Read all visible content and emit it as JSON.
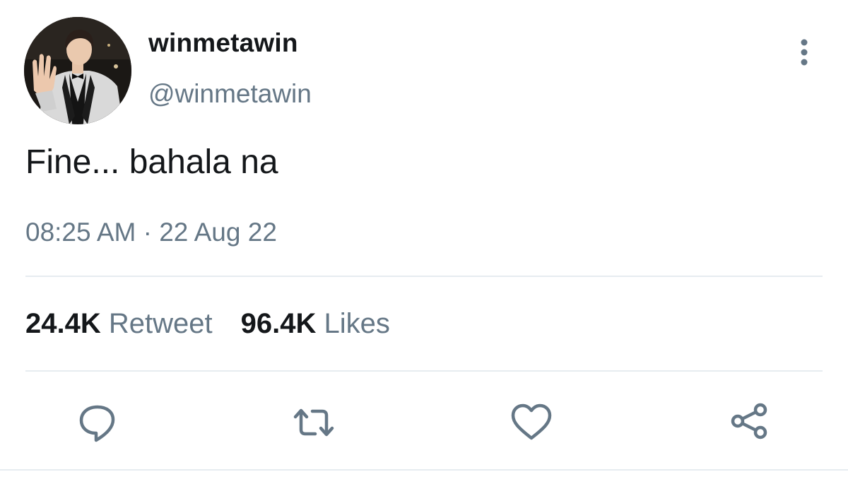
{
  "user": {
    "display_name": "winmetawin",
    "handle": "@winmetawin"
  },
  "tweet": {
    "text": "Fine... bahala na",
    "time": "08:25 AM",
    "separator": "·",
    "date": "22 Aug 22"
  },
  "stats": {
    "retweets_count": "24.4K",
    "retweets_label": "Retweet",
    "likes_count": "96.4K",
    "likes_label": "Likes"
  },
  "icons": {
    "more": "more-vertical-icon",
    "reply": "reply-icon",
    "retweet": "retweet-icon",
    "like": "heart-icon",
    "share": "share-icon"
  },
  "colors": {
    "text": "#14171a",
    "secondary": "#657786",
    "divider": "#e6ecf0"
  }
}
